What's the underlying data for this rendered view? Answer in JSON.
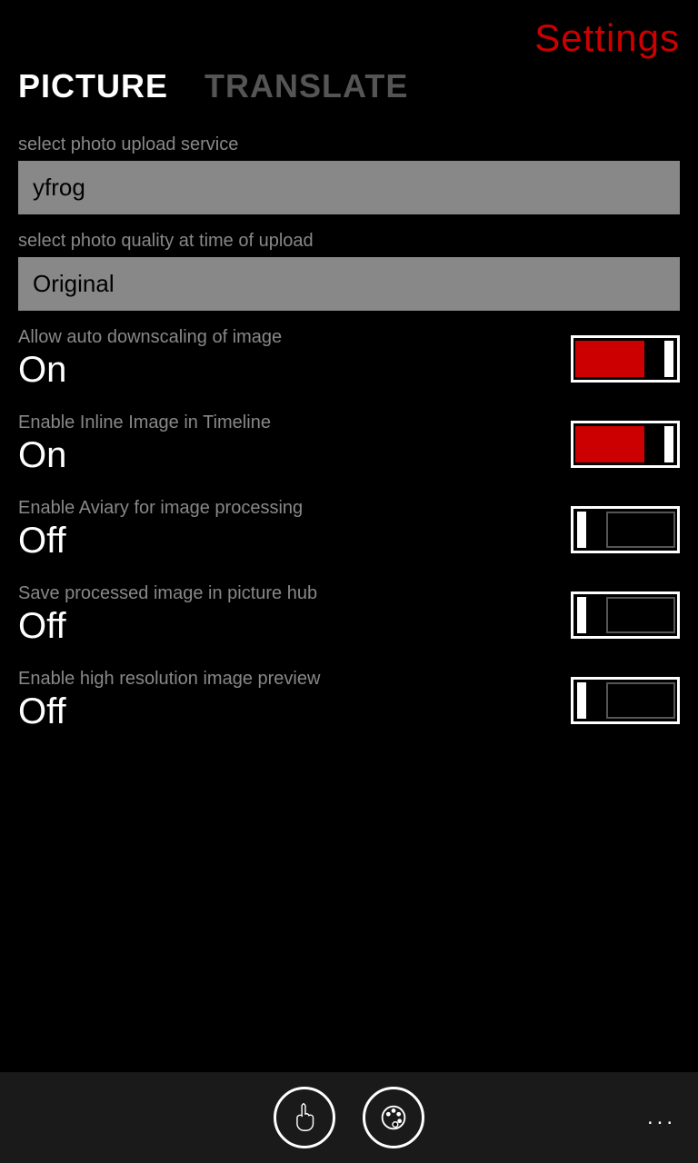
{
  "header": {
    "title": "Settings"
  },
  "tabs": [
    {
      "id": "picture",
      "label": "PICTURE",
      "active": true
    },
    {
      "id": "translate",
      "label": "TRANSLATE",
      "active": false
    }
  ],
  "settings": {
    "upload_service_label": "select photo upload service",
    "upload_service_value": "yfrog",
    "photo_quality_label": "select photo quality at time of upload",
    "photo_quality_value": "Original",
    "toggles": [
      {
        "id": "auto_downscaling",
        "label": "Allow auto downscaling of image",
        "value": "On",
        "enabled": true
      },
      {
        "id": "inline_image",
        "label": "Enable Inline Image in Timeline",
        "value": "On",
        "enabled": true
      },
      {
        "id": "aviary",
        "label": "Enable Aviary for image processing",
        "value": "Off",
        "enabled": false
      },
      {
        "id": "save_processed",
        "label": "Save processed image in picture hub",
        "value": "Off",
        "enabled": false
      },
      {
        "id": "high_res",
        "label": "Enable high resolution image preview",
        "value": "Off",
        "enabled": false
      }
    ]
  },
  "bottom_bar": {
    "more_label": "..."
  }
}
